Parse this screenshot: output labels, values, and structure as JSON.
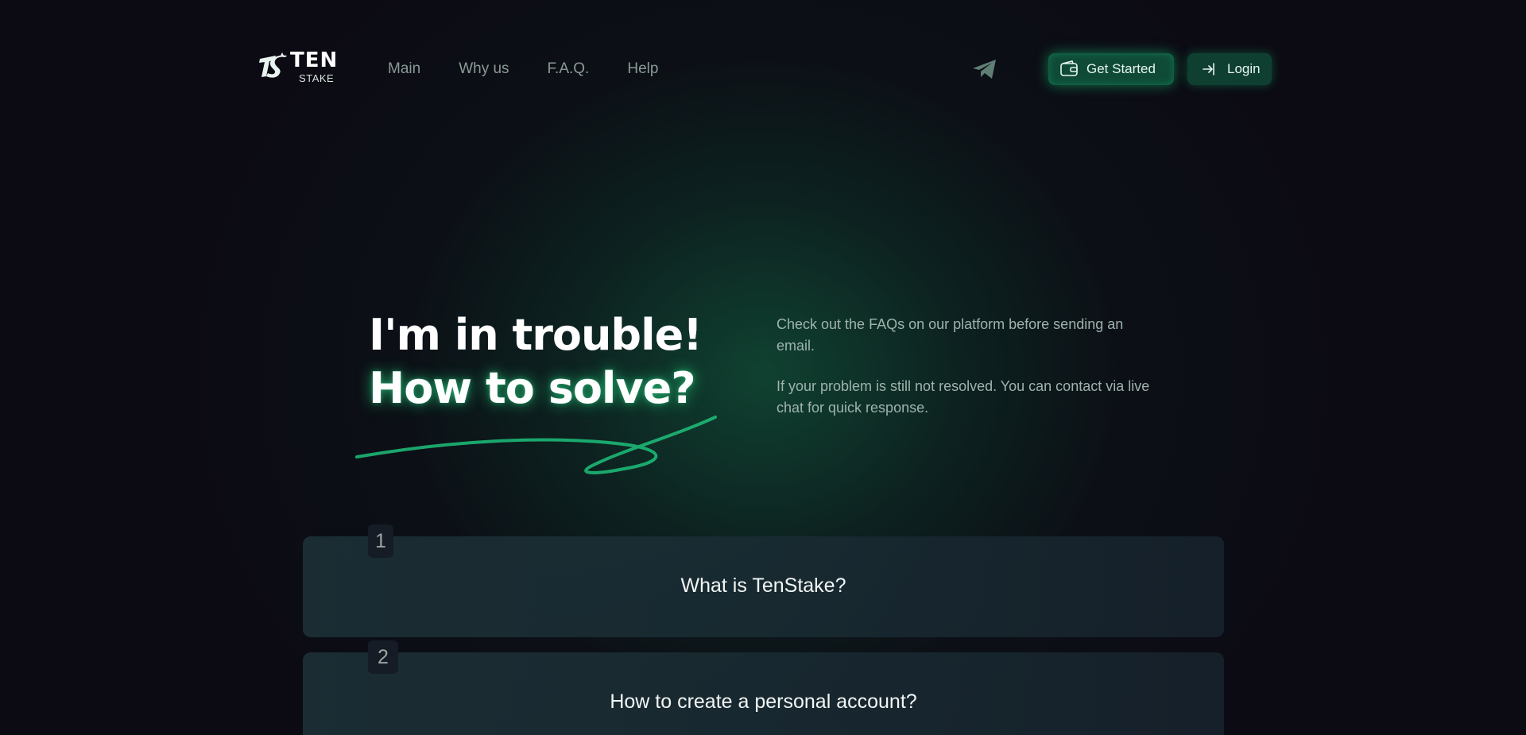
{
  "brand": {
    "name": "TEN",
    "sub": "STAKE"
  },
  "nav": {
    "items": [
      {
        "label": "Main"
      },
      {
        "label": "Why us"
      },
      {
        "label": "F.A.Q."
      },
      {
        "label": "Help"
      }
    ],
    "get_started": "Get Started",
    "login": "Login"
  },
  "hero": {
    "title_line1": "I'm in trouble!",
    "title_line2": "How to solve?",
    "text1": "Check out the FAQs on our platform before sending an email.",
    "text2": "If your problem is still not resolved. You can contact via live chat for quick response."
  },
  "faq": [
    {
      "number": "1",
      "question": "What is TenStake?"
    },
    {
      "number": "2",
      "question": "How to create a personal account?"
    }
  ],
  "colors": {
    "background": "#0c0b14",
    "accent": "#1fbf7a",
    "button_bg": "#0f4a37",
    "muted_text": "#9fb3ad"
  },
  "icons": {
    "logo": "ts-logo-icon",
    "telegram": "telegram-icon",
    "wallet": "wallet-icon",
    "login": "login-arrow-icon"
  }
}
